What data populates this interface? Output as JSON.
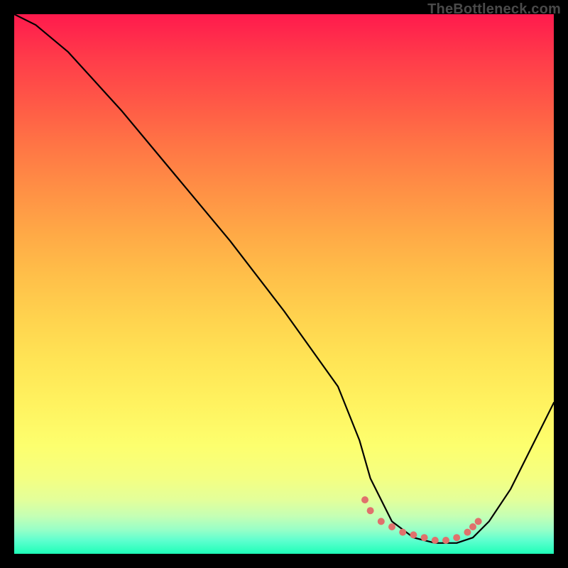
{
  "watermark": "TheBottleneck.com",
  "chart_data": {
    "type": "line",
    "title": "",
    "xlabel": "",
    "ylabel": "",
    "xlim": [
      0,
      100
    ],
    "ylim": [
      0,
      100
    ],
    "series": [
      {
        "name": "curve",
        "x": [
          0,
          4,
          10,
          20,
          30,
          40,
          50,
          60,
          64,
          66,
          70,
          74,
          78,
          82,
          85,
          88,
          92,
          96,
          100
        ],
        "values": [
          100,
          98,
          93,
          82,
          70,
          58,
          45,
          31,
          21,
          14,
          6,
          3,
          2,
          2,
          3,
          6,
          12,
          20,
          28
        ]
      }
    ],
    "markers": {
      "name": "highlight-segment",
      "color": "#e0716c",
      "points": [
        {
          "x": 65,
          "y": 10
        },
        {
          "x": 66,
          "y": 8
        },
        {
          "x": 68,
          "y": 6
        },
        {
          "x": 70,
          "y": 5
        },
        {
          "x": 72,
          "y": 4
        },
        {
          "x": 74,
          "y": 3.5
        },
        {
          "x": 76,
          "y": 3
        },
        {
          "x": 78,
          "y": 2.5
        },
        {
          "x": 80,
          "y": 2.5
        },
        {
          "x": 82,
          "y": 3
        },
        {
          "x": 84,
          "y": 4
        },
        {
          "x": 85,
          "y": 5
        },
        {
          "x": 86,
          "y": 6
        }
      ]
    },
    "gradient_background": {
      "direction": "vertical",
      "top_color": "#ff1a4d",
      "bottom_color": "#1effb8"
    }
  }
}
